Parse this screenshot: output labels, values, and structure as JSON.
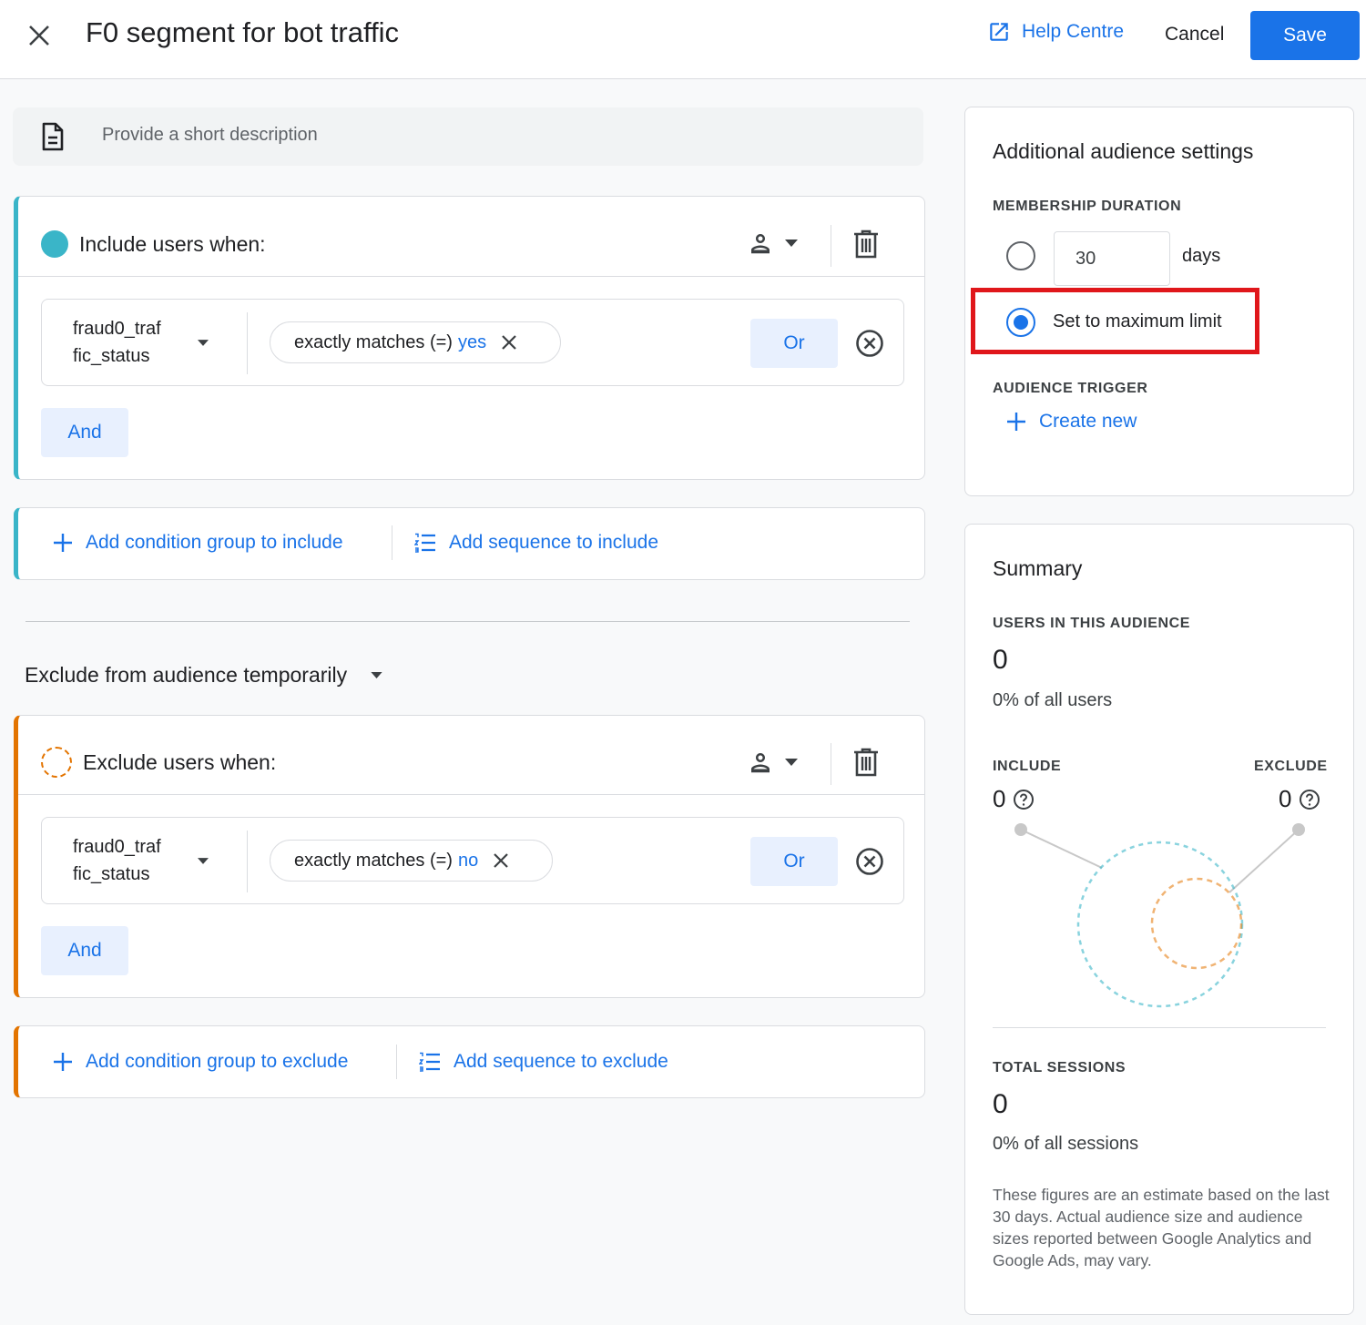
{
  "header": {
    "title": "F0 segment for bot traffic",
    "help_label": "Help Centre",
    "cancel_label": "Cancel",
    "save_label": "Save"
  },
  "description": {
    "placeholder": "Provide a short description"
  },
  "include_group": {
    "title": "Include users when:",
    "condition": {
      "dimension_line1": "fraud0_traf",
      "dimension_line2": "fic_status",
      "operator": "exactly matches (=)",
      "value": "yes"
    },
    "or_label": "Or",
    "and_label": "And"
  },
  "include_actions": {
    "add_group": "Add condition group to include",
    "add_sequence": "Add sequence to include"
  },
  "exclude_mode": {
    "label": "Exclude from audience temporarily"
  },
  "exclude_group": {
    "title": "Exclude users when:",
    "condition": {
      "dimension_line1": "fraud0_traf",
      "dimension_line2": "fic_status",
      "operator": "exactly matches (=)",
      "value": "no"
    },
    "or_label": "Or",
    "and_label": "And"
  },
  "exclude_actions": {
    "add_group": "Add condition group to exclude",
    "add_sequence": "Add sequence to exclude"
  },
  "settings": {
    "title": "Additional audience settings",
    "membership_label": "MEMBERSHIP DURATION",
    "days_value": "30",
    "days_unit": "days",
    "max_limit_label": "Set to maximum limit",
    "selected_option": "Set to maximum limit",
    "trigger_label": "AUDIENCE TRIGGER",
    "create_new_label": "Create new"
  },
  "summary": {
    "title": "Summary",
    "users_label": "USERS IN THIS AUDIENCE",
    "users_value": "0",
    "users_pct": "0% of all users",
    "include_label": "INCLUDE",
    "include_value": "0",
    "exclude_label": "EXCLUDE",
    "exclude_value": "0",
    "sessions_label": "TOTAL SESSIONS",
    "sessions_value": "0",
    "sessions_pct": "0% of all sessions",
    "note": "These figures are an estimate based on the last 30 days. Actual audience size and audience sizes reported between Google Analytics and Google Ads, may vary."
  },
  "colors": {
    "accent": "#1a73e8",
    "include": "#3ab5c8",
    "exclude": "#e37400",
    "highlight": "#e0171b"
  }
}
